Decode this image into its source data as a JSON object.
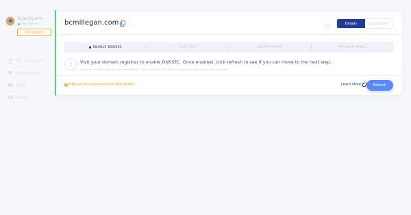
{
  "account": {
    "name": "brantly.eth",
    "network": "Main Network",
    "disconnect_label": "Disconnect"
  },
  "nav": {
    "items": [
      {
        "label": "My Account",
        "icon": "user-icon"
      },
      {
        "label": "Favourites",
        "icon": "heart-icon"
      },
      {
        "label": "FAQ",
        "icon": "faq-icon"
      },
      {
        "label": "About",
        "icon": "chat-icon"
      }
    ]
  },
  "domain": {
    "name": "bcmillegan.com"
  },
  "tabs": {
    "details": "Details",
    "subdomains": "Subdomains"
  },
  "steps": {
    "items": [
      "ENABLE DNSSEC",
      "ADD TEXT",
      "SUBMIT PROOF",
      "MANAGE NAME"
    ]
  },
  "step_content": {
    "number": "1",
    "title": "Visit your domain registrar to enable DNSSEC. Once enabled, click refresh to see if you can move to the next step.",
    "subtitle": "Visit your domain registrar to enable DNSSEC. Once enabled click refresh to see if you can move to the next step."
  },
  "status": {
    "dns_message": "DNS server responded with NXDOMAIN",
    "learn_more": "Learn More",
    "refresh_label": "Refresh"
  },
  "colors": {
    "accent_blue": "#5a8afc",
    "navy": "#253b8f",
    "warning": "#f5a623",
    "success": "#42e068"
  }
}
